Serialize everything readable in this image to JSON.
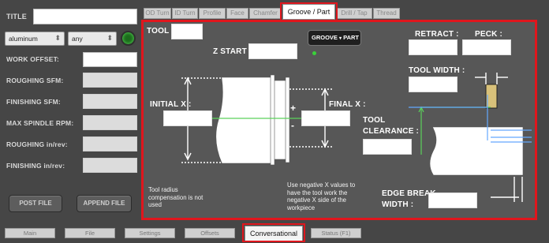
{
  "sidebar": {
    "title_label": "TITLE",
    "material": "aluminum",
    "unit": "any",
    "work_offset_label": "WORK OFFSET:",
    "roughing_sfm_label": "ROUGHING SFM:",
    "finishing_sfm_label": "FINISHING SFM:",
    "max_spindle_label": "MAX SPINDLE RPM:",
    "roughing_in_rev_label": "ROUGHING in/rev:",
    "finishing_in_rev_label": "FINISHING in/rev:",
    "post_button": "POST FILE",
    "append_button": "APPEND FILE"
  },
  "top_tabs": [
    {
      "label": "OD Turn"
    },
    {
      "label": "ID Turn"
    },
    {
      "label": "Profile"
    },
    {
      "label": "Face"
    },
    {
      "label": "Chamfer"
    },
    {
      "label": "Groove / Part"
    },
    {
      "label": "Drill / Tap"
    },
    {
      "label": "Thread"
    }
  ],
  "panel": {
    "tool_label": "TOOL :",
    "toggle_groove": "GROOVE",
    "toggle_part": "PART",
    "retract_label": "RETRACT :",
    "peck_label": "PECK :",
    "z_start_label": "Z START :",
    "tool_width_label": "TOOL WIDTH :",
    "initial_x_label": "INITIAL X :",
    "final_x_label": "FINAL X :",
    "plus": "+",
    "minus": "-",
    "tool_clearance_label_1": "TOOL",
    "tool_clearance_label_2": "CLEARANCE :",
    "note_left": "Tool radius compensation is not used",
    "note_center": "Use negative X values to have the tool work the negative X side of the workpiece",
    "edge_break_label_1": "EDGE BREAK",
    "edge_break_label_2": "WIDTH :"
  },
  "bottom_tabs": [
    {
      "label": "Main"
    },
    {
      "label": "File"
    },
    {
      "label": "Settings"
    },
    {
      "label": "Offsets"
    },
    {
      "label": "Conversational"
    },
    {
      "label": "Status (F1)"
    }
  ],
  "colors": {
    "highlight": "#e0161d",
    "panel_bg": "#575757",
    "led_green": "#3ad13a"
  }
}
